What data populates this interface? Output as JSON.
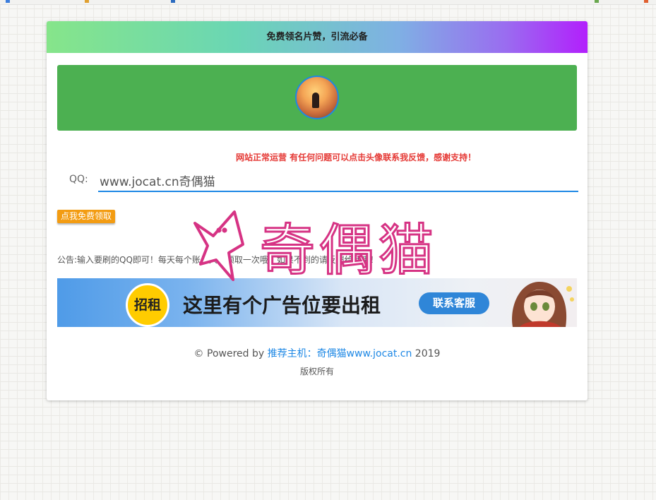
{
  "header": {
    "title": "免费领名片赞，引流必备"
  },
  "notice": "网站正常运营 有任何问题可以点击头像联系我反馈，感谢支持！",
  "form": {
    "qq_label": "QQ:",
    "qq_value": "www.jocat.cn奇偶猫",
    "submit_label": "点我免费领取"
  },
  "announcement": "公告:输入要刷的QQ即可！每天每个账号只能领取一次哦，如果不到的请反馈给我哦！",
  "ad": {
    "badge": "招租",
    "text": "这里有个广告位要出租",
    "button": "联系客服"
  },
  "watermark": {
    "text": "奇偶猫"
  },
  "footer": {
    "powered_prefix": "© Powered by ",
    "link_text": "推荐主机：奇偶猫www.jocat.cn",
    "year": " 2019",
    "rights": "版权所有"
  },
  "colors": {
    "banner": "#4cb051",
    "notice": "#e53935",
    "accent": "#1e88e5",
    "button": "#f39c12",
    "watermark": "#d63384"
  }
}
